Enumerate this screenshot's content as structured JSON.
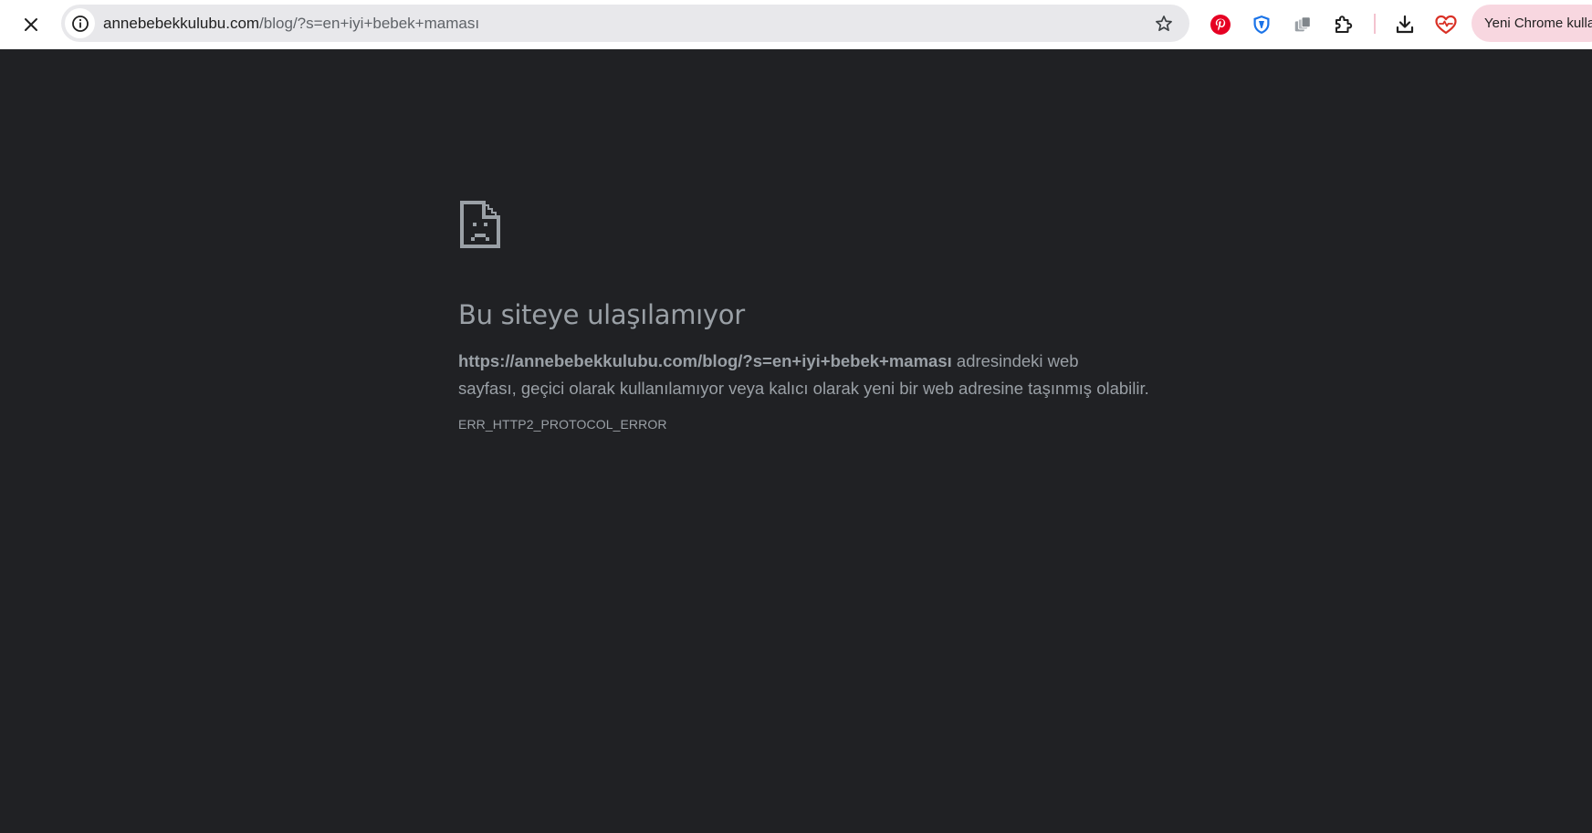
{
  "browser": {
    "url": {
      "host": "annebebekkulubu.com",
      "path": "/blog/?s=en+iyi+bebek+maması"
    },
    "profile_chip_label": "Yeni Chrome kullanıcısı",
    "icons": {
      "stop": "close-icon",
      "site_info": "info-icon",
      "bookmark": "star-icon",
      "extensions": [
        "pinterest-icon",
        "shield-icon",
        "copy-icon",
        "puzzle-icon",
        "download-icon",
        "heart-icon"
      ]
    },
    "colors": {
      "pinterest": "#e60023",
      "shield": "#1a73e8",
      "heart": "#d93025",
      "page_bg": "#202124",
      "text": "#9aa0a6"
    }
  },
  "error_page": {
    "title": "Bu siteye ulaşılamıyor",
    "url_bold": "https://annebebekkulubu.com/blog/?s=en+iyi+bebek+maması",
    "desc_line1_suffix": " adresindeki web",
    "desc_line2": "sayfası, geçici olarak kullanılamıyor veya kalıcı olarak yeni bir web adresine taşınmış olabilir.",
    "error_code": "ERR_HTTP2_PROTOCOL_ERROR"
  }
}
